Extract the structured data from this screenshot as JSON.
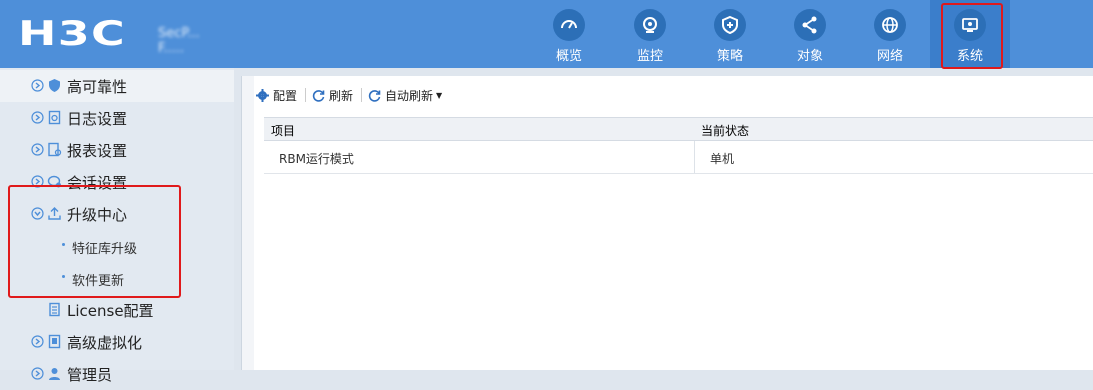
{
  "header": {
    "logo": "H3C",
    "device_name_line1": "SecP...",
    "device_name_line2": "F.....",
    "nav": [
      {
        "label": "概览",
        "icon": "dashboard-icon"
      },
      {
        "label": "监控",
        "icon": "monitor-icon"
      },
      {
        "label": "策略",
        "icon": "shield-icon"
      },
      {
        "label": "对象",
        "icon": "share-icon"
      },
      {
        "label": "网络",
        "icon": "globe-icon"
      },
      {
        "label": "系统",
        "icon": "system-monitor-icon",
        "active": true
      }
    ]
  },
  "sidebar": {
    "items": [
      {
        "label": "高可靠性",
        "icon": "shield-icon"
      },
      {
        "label": "日志设置",
        "icon": "log-icon"
      },
      {
        "label": "报表设置",
        "icon": "report-icon"
      },
      {
        "label": "会话设置",
        "icon": "session-icon"
      },
      {
        "label": "升级中心",
        "icon": "upload-icon"
      },
      {
        "label": "License配置",
        "icon": "license-icon"
      },
      {
        "label": "高级虚拟化",
        "icon": "virtualization-icon"
      },
      {
        "label": "管理员",
        "icon": "admin-icon"
      }
    ],
    "subitems": [
      {
        "label": "特征库升级"
      },
      {
        "label": "软件更新"
      }
    ]
  },
  "toolbar": {
    "config_label": "配置",
    "refresh_label": "刷新",
    "auto_refresh_label": "自动刷新"
  },
  "table": {
    "columns": [
      "项目",
      "当前状态"
    ],
    "rows": [
      [
        "RBM运行模式",
        "单机"
      ]
    ]
  },
  "colors": {
    "header_bg": "#4e8fd9",
    "highlight_red": "#e0191b",
    "sidebar_bg": "#e2e9f1"
  }
}
